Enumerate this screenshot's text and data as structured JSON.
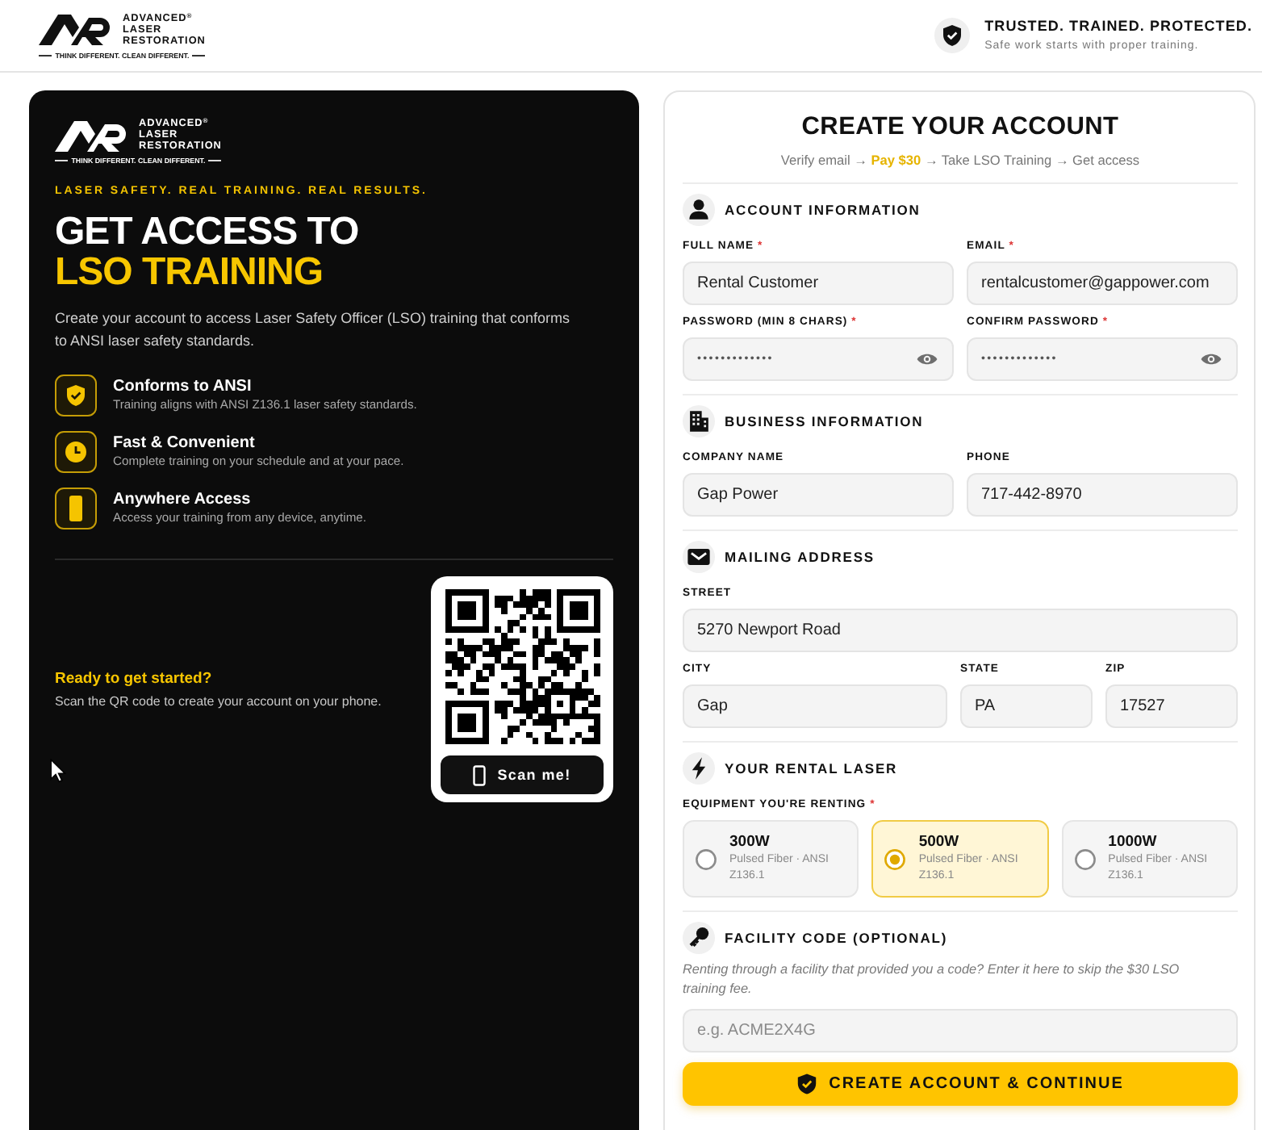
{
  "header": {
    "logo": {
      "lines": [
        "ADVANCED$^{®}$",
        "LASER",
        "RESTORATION"
      ],
      "tagline": "THINK DIFFERENT. CLEAN DIFFERENT."
    },
    "trust": {
      "title": "TRUSTED. TRAINED. PROTECTED.",
      "subtitle": "Safe work starts with proper training."
    }
  },
  "hero": {
    "logo": {
      "lines": [
        "ADVANCED$^{®}$",
        "LASER",
        "RESTORATION"
      ],
      "tagline": "THINK DIFFERENT. CLEAN DIFFERENT."
    },
    "eyebrow": "LASER SAFETY. REAL TRAINING. REAL RESULTS.",
    "heading": {
      "lead": "GET ACCESS TO",
      "highlight": "LSO TRAINING"
    },
    "description": "Create your account to access Laser Safety Officer (LSO) training that conforms to ANSI laser safety standards.",
    "features": [
      {
        "title": "Conforms to ANSI",
        "text": "Training aligns with ANSI Z136.1 laser safety standards."
      },
      {
        "title": "Fast & Convenient",
        "text": "Complete training on your schedule and at your pace."
      },
      {
        "title": "Anywhere Access",
        "text": "Access your training from any device, anytime."
      }
    ],
    "qr": {
      "heading": "Ready to get started?",
      "text": "Scan the QR code to create your account on your phone.",
      "button": "Scan me!"
    }
  },
  "form": {
    "title": "CREATE YOUR ACCOUNT",
    "steps": "Verify email → **Pay $30** → Take LSO Training → Get access",
    "sections": [
      {
        "kind": "fields",
        "title": "ACCOUNT INFORMATION",
        "rows": [
          [
            {
              "kind": "text",
              "label": "FULL NAME",
              "required_mark": "*",
              "value": "Rental Customer"
            },
            {
              "kind": "text",
              "label": "EMAIL",
              "required_mark": "*",
              "value": "rentalcustomer@gappower.com"
            }
          ],
          [
            {
              "kind": "password",
              "label": "PASSWORD (MIN 8 CHARS)",
              "required_mark": "*",
              "value": "•••••••••••••"
            },
            {
              "kind": "password",
              "label": "CONFIRM PASSWORD",
              "required_mark": "*",
              "value": "•••••••••••••"
            }
          ]
        ]
      },
      {
        "kind": "fields",
        "title": "BUSINESS INFORMATION",
        "rows": [
          [
            {
              "kind": "text",
              "label": "COMPANY NAME",
              "value": "Gap Power"
            },
            {
              "kind": "text",
              "label": "PHONE",
              "value": "717-442-8970"
            }
          ]
        ]
      },
      {
        "kind": "fields",
        "title": "MAILING ADDRESS",
        "rows": [
          [
            {
              "kind": "text",
              "label": "STREET",
              "value": "5270 Newport Road"
            }
          ],
          [
            {
              "kind": "text",
              "label": "CITY",
              "value": "Gap"
            },
            {
              "kind": "text",
              "label": "STATE",
              "value": "PA"
            },
            {
              "kind": "text",
              "label": "ZIP",
              "value": "17527"
            }
          ]
        ]
      },
      {
        "kind": "choice",
        "title": "YOUR RENTAL LASER",
        "choice": {
          "label": "EQUIPMENT YOU'RE RENTING",
          "required_mark": "*",
          "options": [
            {
              "title": "300W",
              "text": "Pulsed Fiber · ANSI Z136.1",
              "selected": false
            },
            {
              "title": "500W",
              "text": "Pulsed Fiber · ANSI Z136.1",
              "selected": true
            },
            {
              "title": "1000W",
              "text": "Pulsed Fiber · ANSI Z136.1",
              "selected": false
            }
          ]
        }
      },
      {
        "kind": "fields",
        "title": "FACILITY CODE (OPTIONAL)",
        "note": "Renting through a facility that provided you a code? Enter it here to skip the $30 LSO training fee.",
        "rows": [
          [
            {
              "kind": "text",
              "placeholder": "e.g. ACME2X4G"
            }
          ]
        ]
      }
    ],
    "submit": "CREATE ACCOUNT & CONTINUE"
  }
}
